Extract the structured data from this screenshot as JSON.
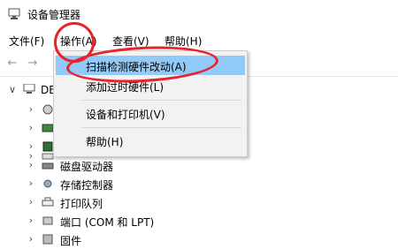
{
  "window": {
    "title": "设备管理器"
  },
  "menubar": {
    "items": [
      {
        "label": "文件(F)"
      },
      {
        "label": "操作(A)"
      },
      {
        "label": "查看(V)"
      },
      {
        "label": "帮助(H)"
      }
    ]
  },
  "toolbar": {
    "back_icon": "back-arrow-icon",
    "forward_icon": "forward-arrow-icon"
  },
  "dropdown": {
    "items": [
      {
        "label": "扫描检测硬件改动(A)",
        "highlighted": true
      },
      {
        "label": "添加过时硬件(L)"
      },
      {
        "label": "设备和打印机(V)"
      },
      {
        "label": "帮助(H)"
      }
    ]
  },
  "tree": {
    "root_label": "DE",
    "rows": [
      {
        "label": ""
      },
      {
        "label": ""
      },
      {
        "label": ""
      },
      {
        "label": ""
      },
      {
        "label": "磁盘驱动器"
      },
      {
        "label": "存储控制器"
      },
      {
        "label": "打印队列"
      },
      {
        "label": "端口 (COM 和 LPT)"
      },
      {
        "label": "固件"
      }
    ]
  },
  "annotation_color": "#e8232a"
}
